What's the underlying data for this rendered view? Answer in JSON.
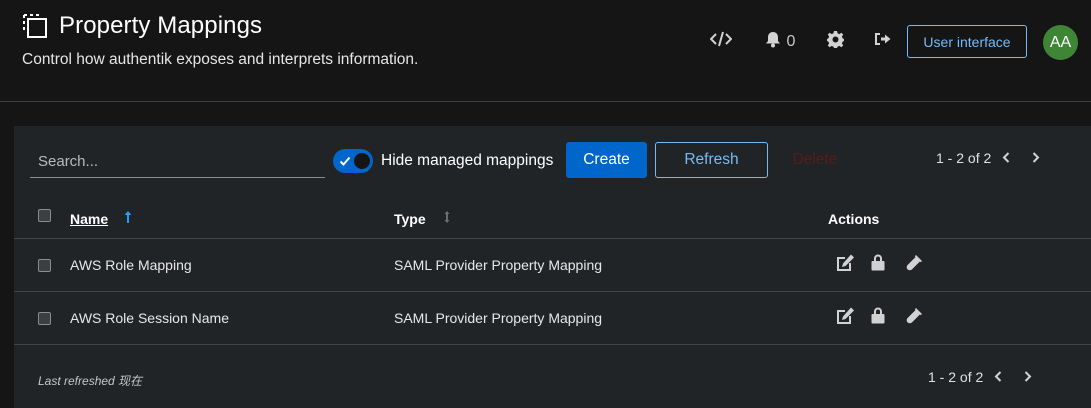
{
  "header": {
    "title": "Property Mappings",
    "description": "Control how authentik exposes and interprets information.",
    "title_icon": "dashed-square-icon",
    "tools": {
      "api_icon": "code-icon",
      "notifications_icon": "bell-icon",
      "notifications_count": "0",
      "settings_icon": "gear-icon",
      "logout_icon": "sign-out-icon",
      "user_interface_label": "User interface",
      "avatar_initials": "AA"
    }
  },
  "toolbar": {
    "search_placeholder": "Search...",
    "hide_managed_label": "Hide managed mappings",
    "hide_managed_on": true,
    "create_label": "Create",
    "refresh_label": "Refresh",
    "delete_label": "Delete"
  },
  "pagination": {
    "range": "1 - 2 of 2"
  },
  "table": {
    "columns": {
      "name": "Name",
      "type": "Type",
      "actions": "Actions"
    },
    "rows": [
      {
        "name": "AWS Role Mapping",
        "type": "SAML Provider Property Mapping"
      },
      {
        "name": "AWS Role Session Name",
        "type": "SAML Provider Property Mapping"
      }
    ]
  },
  "footer": {
    "last_refreshed": "Last refreshed 现在"
  },
  "colors": {
    "background": "#151515",
    "card": "#212427",
    "primary": "#0066cc",
    "link": "#73bcf7",
    "avatar": "#3e8635"
  }
}
